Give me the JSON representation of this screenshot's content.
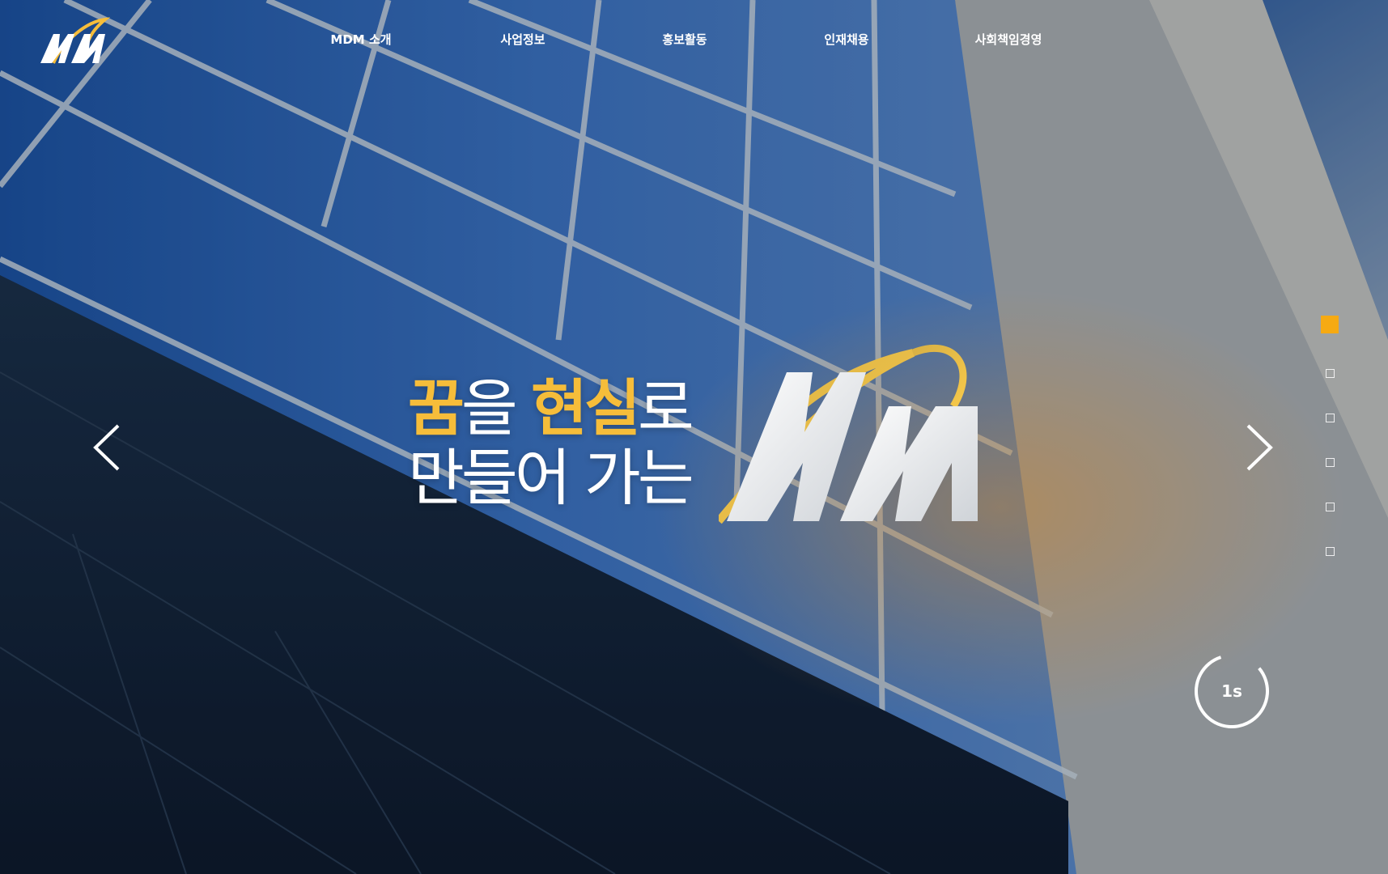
{
  "header": {
    "logo_alt": "MDM",
    "nav": [
      {
        "label": "MDM 소개"
      },
      {
        "label": "사업정보"
      },
      {
        "label": "홍보활동"
      },
      {
        "label": "인재채용"
      },
      {
        "label": "사회책임경영"
      }
    ]
  },
  "hero": {
    "headline": {
      "line1_accent1": "꿈",
      "line1_plain1": "을 ",
      "line1_accent2": "현실",
      "line1_plain2": "로",
      "line2": "만들어 가는"
    },
    "brand_mark": "MM",
    "prev_icon": "chevron-left-icon",
    "next_icon": "chevron-right-icon",
    "slide_count": 6,
    "active_slide": 1,
    "timer_label": "1s"
  },
  "colors": {
    "accent": "#f6bd3a",
    "active_dot": "#f6aa12",
    "text": "#ffffff"
  }
}
